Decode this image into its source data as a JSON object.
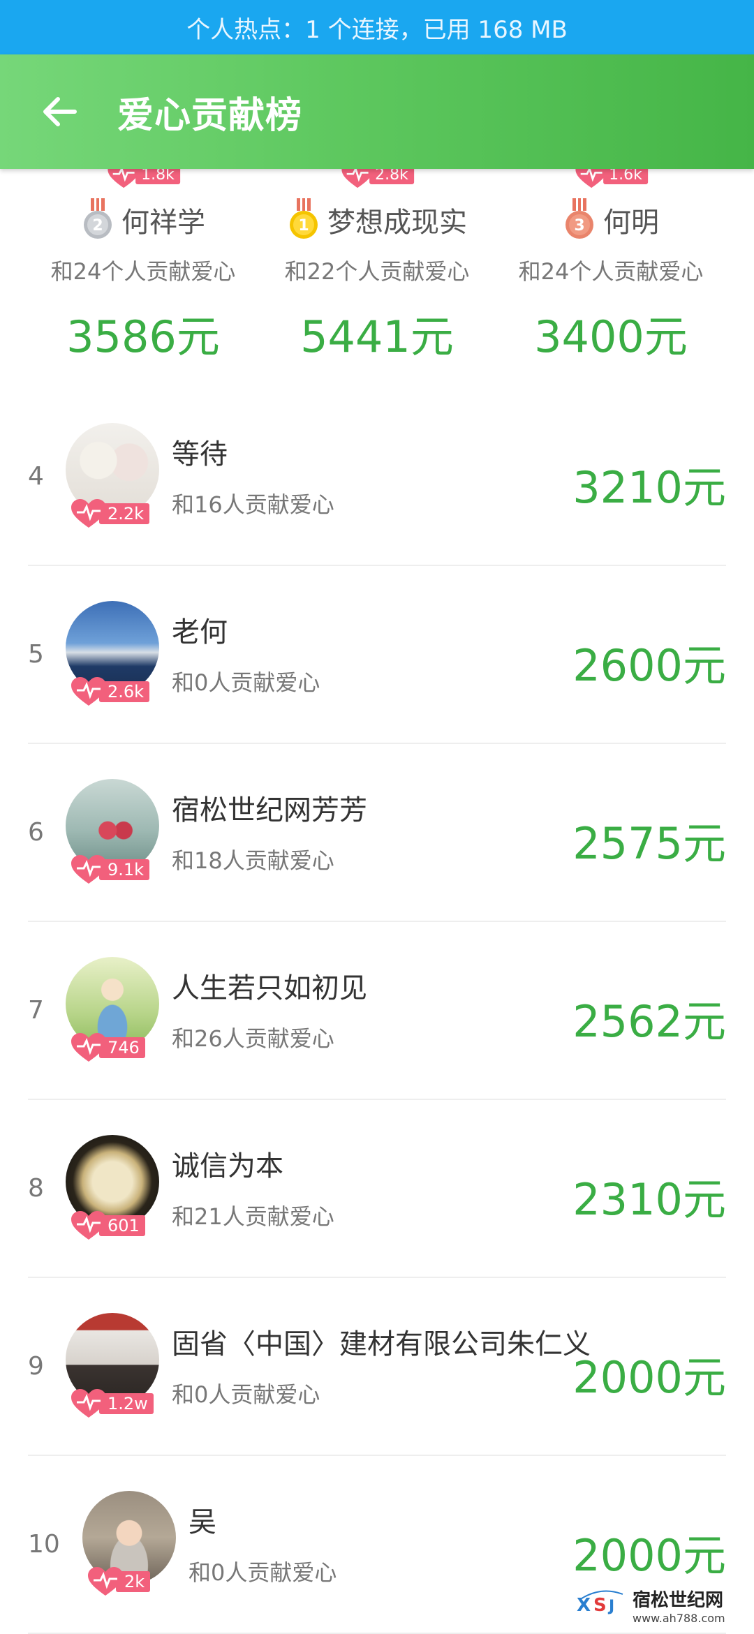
{
  "status_bar": {
    "hotspot_text": "个人热点：1 个连接，已用 168 MB"
  },
  "app_bar": {
    "title": "爱心贡献榜",
    "back_icon": "arrow-left-icon"
  },
  "top_three": [
    {
      "rank": "2",
      "name": "何祥学",
      "likes": "1.8k",
      "contributors": "和24个人贡献爱心",
      "amount": "3586元"
    },
    {
      "rank": "1",
      "name": "梦想成现实",
      "likes": "2.8k",
      "contributors": "和22个人贡献爱心",
      "amount": "5441元"
    },
    {
      "rank": "3",
      "name": "何明",
      "likes": "1.6k",
      "contributors": "和24个人贡献爱心",
      "amount": "3400元"
    }
  ],
  "ranking": [
    {
      "rank": "4",
      "name": "等待",
      "likes": "2.2k",
      "contributors": "和16人贡献爱心",
      "amount": "3210元"
    },
    {
      "rank": "5",
      "name": "老何",
      "likes": "2.6k",
      "contributors": "和0人贡献爱心",
      "amount": "2600元"
    },
    {
      "rank": "6",
      "name": "宿松世纪网芳芳",
      "likes": "9.1k",
      "contributors": "和18人贡献爱心",
      "amount": "2575元"
    },
    {
      "rank": "7",
      "name": "人生若只如初见",
      "likes": "746",
      "contributors": "和26人贡献爱心",
      "amount": "2562元"
    },
    {
      "rank": "8",
      "name": "诚信为本",
      "likes": "601",
      "contributors": "和21人贡献爱心",
      "amount": "2310元"
    },
    {
      "rank": "9",
      "name": "固省〈中国〉建材有限公司朱仁义",
      "likes": "1.2w",
      "contributors": "和0人贡献爱心",
      "amount": "2000元"
    },
    {
      "rank": "10",
      "name": "吴",
      "likes": "2k",
      "contributors": "和0人贡献爱心",
      "amount": "2000元"
    }
  ],
  "watermark": {
    "name": "宿松世纪网",
    "url": "www.ah788.com"
  },
  "colors": {
    "accent_green": "#3aad44",
    "header_green": "#5ec85f",
    "heart_pink": "#f2607c",
    "hotspot_blue": "#1aa7f0"
  }
}
